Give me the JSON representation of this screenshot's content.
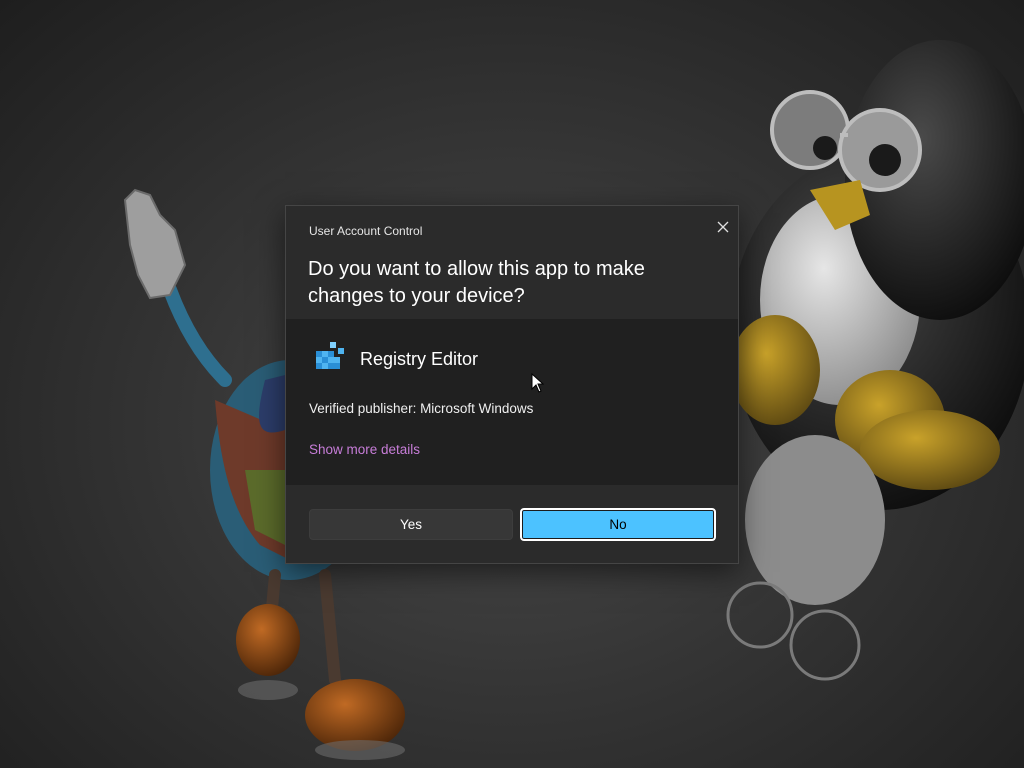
{
  "dialog": {
    "caption": "User Account Control",
    "question": "Do you want to allow this app to make changes to your device?",
    "app_name": "Registry Editor",
    "app_icon": "registry-editor-icon",
    "publisher": "Verified publisher: Microsoft Windows",
    "details_link": "Show more details",
    "yes_label": "Yes",
    "no_label": "No",
    "close_icon": "close-icon"
  },
  "colors": {
    "accent": "#4cc2ff",
    "link": "#c77dd8",
    "dialog_bg": "#2b2b2b",
    "body_bg": "#202020"
  }
}
